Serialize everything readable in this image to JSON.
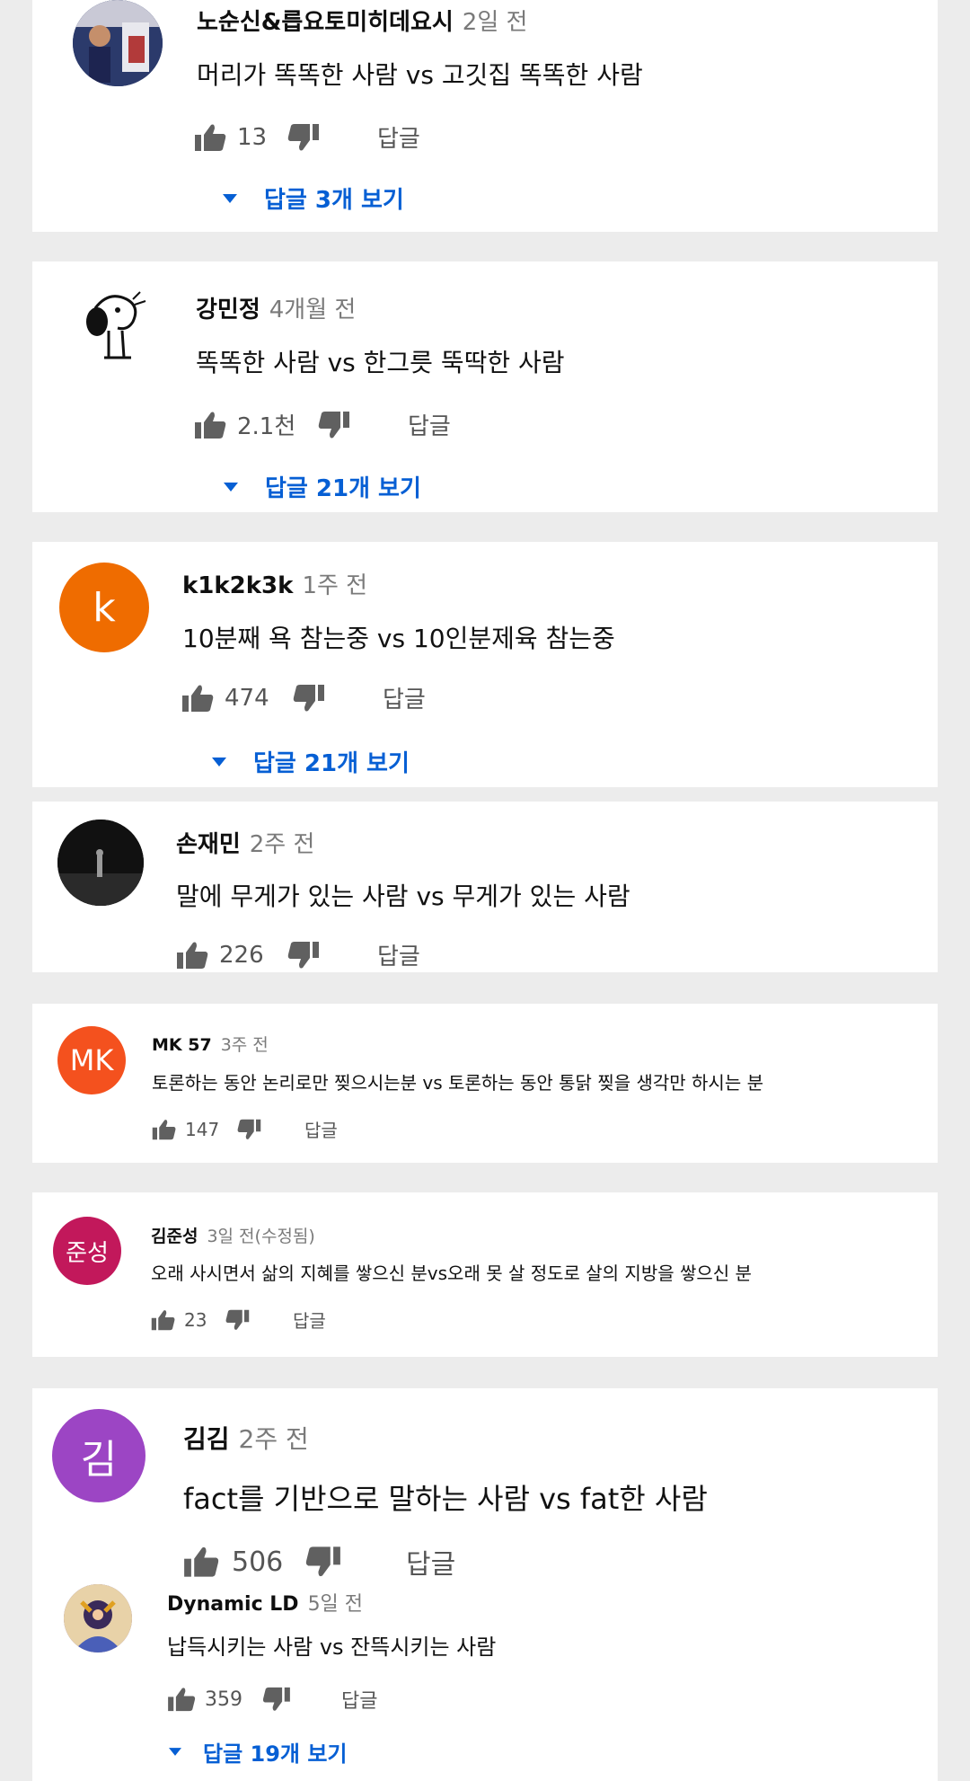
{
  "colors": {
    "page_bg": "#ececec",
    "card_bg": "#ffffff",
    "link_blue": "#065fd4",
    "meta_gray": "#7a7a7a"
  },
  "comments": [
    {
      "author": "노순신&릅요토미히데요시",
      "time": "2일 전",
      "text": "머리가 똑똑한 사람 vs 고깃집 똑똑한 사람",
      "likes": "13",
      "reply_label": "답글",
      "view_replies": "답글 3개 보기",
      "avatar": {
        "type": "photo",
        "icon": "basketball-player-photo",
        "bg": "#2b3a6b"
      }
    },
    {
      "author": "강민정",
      "time": "4개월 전",
      "text": "똑똑한 사람 vs 한그릇 뚝딱한 사람",
      "likes": "2.1천",
      "reply_label": "답글",
      "view_replies": "답글 21개 보기",
      "avatar": {
        "type": "drawing",
        "icon": "snoopy-sketch",
        "bg": "#ffffff"
      }
    },
    {
      "author": "k1k2k3k",
      "time": "1주 전",
      "text": "10분째 욕 참는중 vs 10인분제육 참는중",
      "likes": "474",
      "reply_label": "답글",
      "view_replies": "답글 21개 보기",
      "avatar": {
        "type": "letter",
        "letter": "k",
        "bg": "#ef6c00"
      }
    },
    {
      "author": "손재민",
      "time": "2주 전",
      "text": "말에 무게가 있는 사람 vs 무게가 있는 사람",
      "likes": "226",
      "reply_label": "답글",
      "avatar": {
        "type": "photo",
        "icon": "night-figure-photo",
        "bg": "#111111"
      }
    },
    {
      "author": "MK 57",
      "time": "3주 전",
      "text": "토론하는 동안 논리로만 찢으시는분 vs 토론하는 동안 통닭 찢을 생각만 하시는 분",
      "likes": "147",
      "reply_label": "답글",
      "avatar": {
        "type": "letter",
        "letter": "MK",
        "bg": "#f4511e"
      }
    },
    {
      "author": "김준성",
      "time": "3일 전(수정됨)",
      "text": "오래 사시면서 삶의 지혜를 쌓으신 분vs오래 못 살 정도로 살의 지방을 쌓으신 분",
      "likes": "23",
      "reply_label": "답글",
      "avatar": {
        "type": "letter",
        "letter": "준성",
        "bg": "#c2185b"
      }
    },
    {
      "author": "김김",
      "time": "2주 전",
      "text": "fact를 기반으로 말하는 사람 vs fat한 사람",
      "likes": "506",
      "reply_label": "답글",
      "avatar": {
        "type": "letter",
        "letter": "김",
        "bg": "#9c45c4"
      }
    },
    {
      "author": "Dynamic LD",
      "time": "5일 전",
      "text": "납득시키는 사람 vs 잔뜩시키는 사람",
      "likes": "359",
      "reply_label": "답글",
      "view_replies": "답글 19개 보기",
      "avatar": {
        "type": "photo",
        "icon": "colorful-character-photo",
        "bg": "#6a4a8c"
      }
    }
  ]
}
